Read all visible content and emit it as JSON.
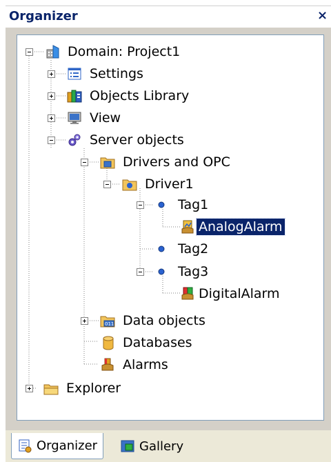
{
  "window": {
    "title": "Organizer",
    "close_glyph": "×"
  },
  "tree": {
    "nodes": [
      {
        "label": "Domain: Project1",
        "icon": "domain-icon",
        "expanded": true
      },
      {
        "label": "Settings",
        "icon": "settings-icon",
        "expanded": false
      },
      {
        "label": "Objects Library",
        "icon": "objects-library-icon",
        "expanded": false
      },
      {
        "label": "View",
        "icon": "view-icon",
        "expanded": false
      },
      {
        "label": "Server objects",
        "icon": "server-objects-icon",
        "expanded": true
      },
      {
        "label": "Drivers and OPC",
        "icon": "drivers-folder-icon",
        "expanded": true
      },
      {
        "label": "Driver1",
        "icon": "driver-icon",
        "expanded": true
      },
      {
        "label": "Tag1",
        "icon": "tag-icon",
        "expanded": true
      },
      {
        "label": "AnalogAlarm",
        "icon": "analog-alarm-icon",
        "selected": true
      },
      {
        "label": "Tag2",
        "icon": "tag-icon"
      },
      {
        "label": "Tag3",
        "icon": "tag-icon",
        "expanded": true
      },
      {
        "label": "DigitalAlarm",
        "icon": "digital-alarm-icon"
      },
      {
        "label": "Data objects",
        "icon": "data-objects-icon",
        "expanded": false
      },
      {
        "label": "Databases",
        "icon": "databases-icon"
      },
      {
        "label": "Alarms",
        "icon": "alarms-icon"
      },
      {
        "label": "Explorer",
        "icon": "explorer-folder-icon",
        "expanded": false
      }
    ]
  },
  "tabs": [
    {
      "label": "Organizer",
      "icon": "organizer-tab-icon",
      "active": true
    },
    {
      "label": "Gallery",
      "icon": "gallery-tab-icon",
      "active": false
    }
  ],
  "colors": {
    "selection": "#0a246a",
    "tree_lines": "#808080",
    "title_text": "#0a246a"
  }
}
